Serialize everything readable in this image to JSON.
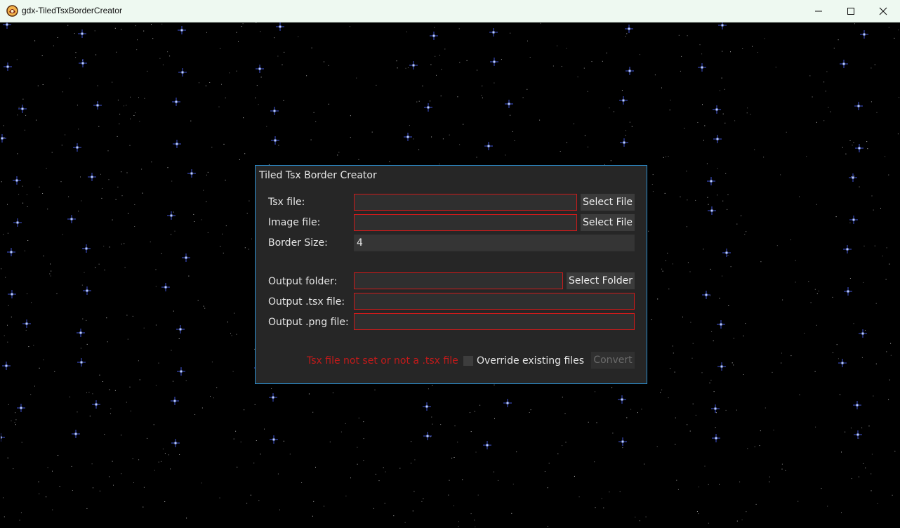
{
  "window": {
    "title": "gdx-TiledTsxBorderCreator",
    "controls": [
      "minimize-icon",
      "maximize-icon",
      "close-icon"
    ]
  },
  "dialog": {
    "title": "Tiled Tsx Border Creator",
    "tsx_file": {
      "label": "Tsx file:",
      "value": "",
      "button": "Select File"
    },
    "image_file": {
      "label": "Image file:",
      "value": "",
      "button": "Select File"
    },
    "border_size": {
      "label": "Border Size:",
      "value": "4"
    },
    "output_folder": {
      "label": "Output folder:",
      "value": "",
      "button": "Select Folder"
    },
    "output_tsx": {
      "label": "Output .tsx file:",
      "value": ""
    },
    "output_png": {
      "label": "Output .png file:",
      "value": ""
    },
    "error_message": "Tsx file not set or not a .tsx file",
    "override_label": "Override existing files",
    "override_checked": false,
    "convert_button": "Convert",
    "convert_enabled": false
  },
  "colors": {
    "accent_border": "#2c8fd0",
    "error": "#c21a1a",
    "star": "#4a63ff"
  }
}
